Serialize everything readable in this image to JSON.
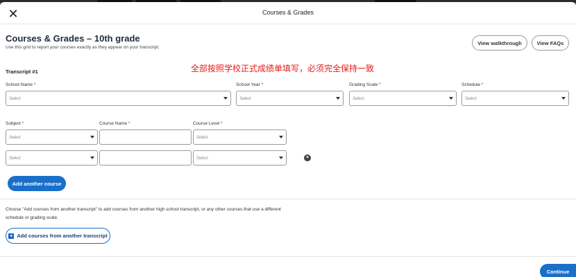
{
  "modal": {
    "title": "Courses & Grades",
    "close_glyph": "✕"
  },
  "page": {
    "title": "Courses & Grades – 10th grade",
    "subtitle": "Use this grid to report your courses exactly as they appear on your transcript."
  },
  "actions": {
    "walkthrough_label": "View walkthrough",
    "faqs_label": "View FAQs"
  },
  "annotation": "全部按照学校正式成绩单填写，必须完全保持一致",
  "transcript": {
    "label": "Transcript #1",
    "school_fields": [
      {
        "label": "School Name",
        "required": "*",
        "value": "Select"
      },
      {
        "label": "School Year",
        "required": "*",
        "value": "Select"
      },
      {
        "label": "Grading Scale",
        "required": "*",
        "value": "Select"
      },
      {
        "label": "Schedule",
        "required": "*",
        "value": "Select"
      }
    ],
    "course_columns": {
      "subject": {
        "label": "Subject",
        "required": "*"
      },
      "course_name": {
        "label": "Course Name",
        "required": "*"
      },
      "course_level": {
        "label": "Course Level",
        "required": "*"
      }
    },
    "course_rows": [
      {
        "subject": "Select",
        "course_name": "",
        "course_level": "Select"
      },
      {
        "subject": "Select",
        "course_name": "",
        "course_level": "Select"
      }
    ],
    "remove_glyph": "×",
    "add_course_label": "Add another course"
  },
  "other_transcript": {
    "help_text": "Choose \"Add courses from another transcript\" to add courses from another high school transcript, or any other courses that use a different schedule or grading scale.",
    "button_label": "Add courses from another transcript",
    "plus_glyph": "+"
  },
  "footer": {
    "continue_label": "Continue"
  },
  "colors": {
    "primary": "#1a6fc9",
    "annotation_red": "#e31b1b",
    "required_red": "#d0021b"
  }
}
